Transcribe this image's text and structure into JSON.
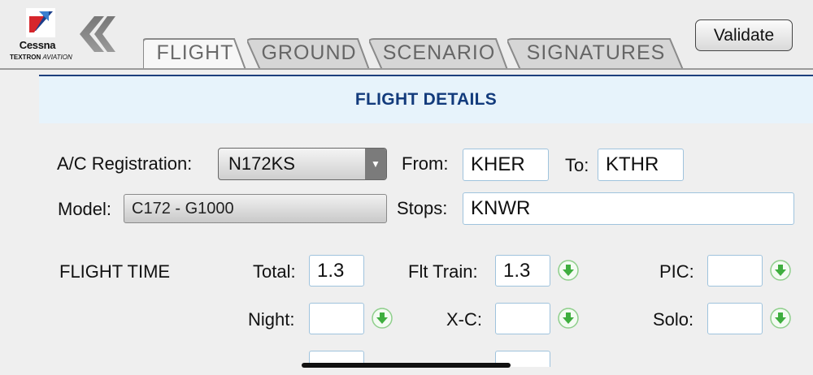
{
  "logo": {
    "brand": "Cessna",
    "sub_bold": "TEXTRON",
    "sub_regular": "AVIATION",
    "icon": "cessna-logo-icon"
  },
  "header": {
    "back_icon": "double-chevron-left-icon",
    "validate_label": "Validate"
  },
  "tabs": [
    {
      "label": "FLIGHT",
      "active": true
    },
    {
      "label": "GROUND",
      "active": false
    },
    {
      "label": "SCENARIO",
      "active": false
    },
    {
      "label": "SIGNATURES",
      "active": false
    }
  ],
  "section": {
    "title": "FLIGHT DETAILS"
  },
  "details": {
    "registration_label": "A/C Registration:",
    "registration_value": "N172KS",
    "from_label": "From:",
    "from_value": "KHER",
    "to_label": "To:",
    "to_value": "KTHR",
    "model_label": "Model:",
    "model_value": "C172 - G1000",
    "stops_label": "Stops:",
    "stops_value": "KNWR"
  },
  "flight_time": {
    "heading": "FLIGHT TIME",
    "total_label": "Total:",
    "total_value": "1.3",
    "flt_train_label": "Flt Train:",
    "flt_train_value": "1.3",
    "pic_label": "PIC:",
    "pic_value": "",
    "night_label": "Night:",
    "night_value": "",
    "xc_label": "X-C:",
    "xc_value": "",
    "solo_label": "Solo:",
    "solo_value": ""
  },
  "colors": {
    "banner_bg": "#e7f3fb",
    "banner_text": "#133b7c",
    "field_border": "#9fc3dd",
    "copy_icon": "#3fae3f"
  }
}
